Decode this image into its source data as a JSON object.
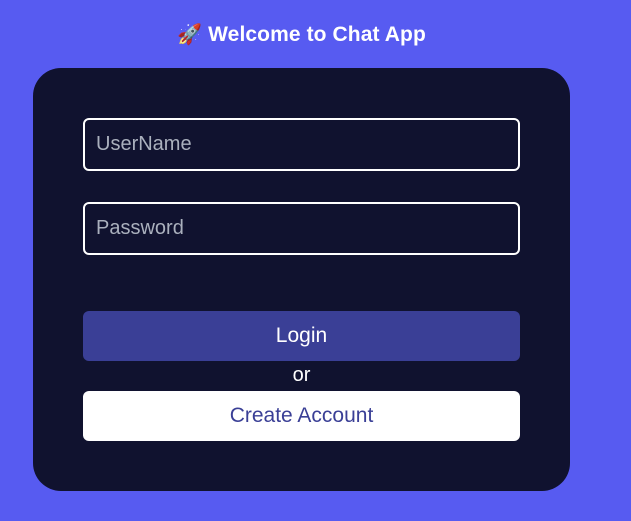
{
  "header": {
    "icon": "rocket-icon",
    "icon_glyph": "🚀",
    "title": "Welcome to Chat App"
  },
  "form": {
    "username": {
      "placeholder": "UserName",
      "value": ""
    },
    "password": {
      "placeholder": "Password",
      "value": ""
    },
    "login_label": "Login",
    "separator": "or",
    "create_label": "Create Account"
  },
  "colors": {
    "background": "#575bf1",
    "card": "#10122f",
    "login_button": "#3a3f96",
    "create_button": "#ffffff",
    "create_text": "#3a3f96"
  }
}
